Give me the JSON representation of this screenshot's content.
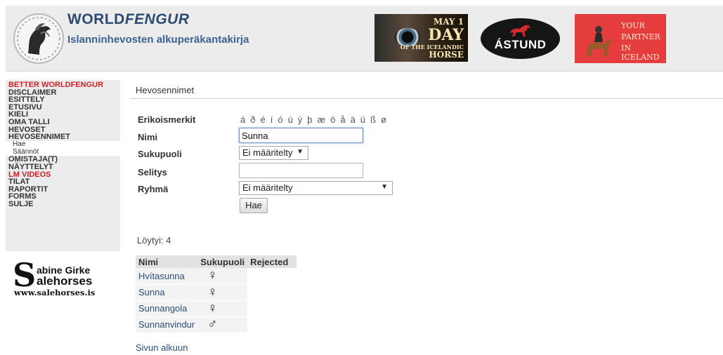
{
  "header": {
    "title_plain": "WORLD",
    "title_italic": "FENGUR",
    "subtitle": "Islanninhevosten alkuperäkantakirja",
    "ads": {
      "day": {
        "line1": "MAY 1",
        "line2": "DAY",
        "line3": "OF THE ICELANDIC",
        "line4": "HORSE"
      },
      "astund": {
        "name": "ÁSTUND"
      },
      "partner": {
        "line1": "YOUR",
        "line2": "PARTNER",
        "line3": "IN ICELAND"
      }
    }
  },
  "sidebar": {
    "items": [
      {
        "label": "BETTER WORLDFENGUR",
        "red": true
      },
      {
        "label": "DISCLAIMER"
      },
      {
        "label": "ESITTELY"
      },
      {
        "label": "ETUSIVU"
      },
      {
        "label": "KIELI"
      },
      {
        "label": "OMA TALLI"
      },
      {
        "label": "HEVOSET"
      },
      {
        "label": "HEVOSENNIMET"
      }
    ],
    "sub_items": [
      "Hae",
      "Säännöt"
    ],
    "items_after": [
      {
        "label": "OMISTAJA(T)"
      },
      {
        "label": "NÄYTTELYT"
      },
      {
        "label": "LM VIDEOS",
        "red": true
      },
      {
        "label": "TILAT"
      },
      {
        "label": "RAPORTIT"
      },
      {
        "label": "FORMS"
      },
      {
        "label": "SULJE"
      }
    ],
    "sponsor": {
      "line1": "abine Girke",
      "line2": "alehorses",
      "url": "www.salehorses.is"
    }
  },
  "main": {
    "page_title": "Hevosennimet",
    "form": {
      "special_chars_label": "Erikoismerkit",
      "special_chars": [
        "á",
        "ð",
        "é",
        "í",
        "ó",
        "ú",
        "ý",
        "þ",
        "æ",
        "ö",
        "å",
        "ä",
        "ü",
        "ß",
        "ø"
      ],
      "name_label": "Nimi",
      "name_value": "Sunna",
      "gender_label": "Sukupuoli",
      "gender_value": "Ei määritelty",
      "description_label": "Selitys",
      "description_value": "",
      "group_label": "Ryhmä",
      "group_value": "Ei määritelty",
      "search_button": "Hae"
    },
    "found": "Löytyi: 4",
    "table": {
      "headers": [
        "Nimi",
        "Sukupuoli",
        "Rejected"
      ],
      "rows": [
        {
          "name": "Hvítasunna",
          "sex": "♀"
        },
        {
          "name": "Sunna",
          "sex": "♀"
        },
        {
          "name": "Sunnangola",
          "sex": "♀"
        },
        {
          "name": "Sunnanvindur",
          "sex": "♂"
        }
      ]
    },
    "back_to_top": "Sivun alkuun"
  },
  "colors": {
    "accent_blue": "#2c4b6e",
    "menu_red": "#d0202a",
    "header_bg": "#ececec"
  }
}
